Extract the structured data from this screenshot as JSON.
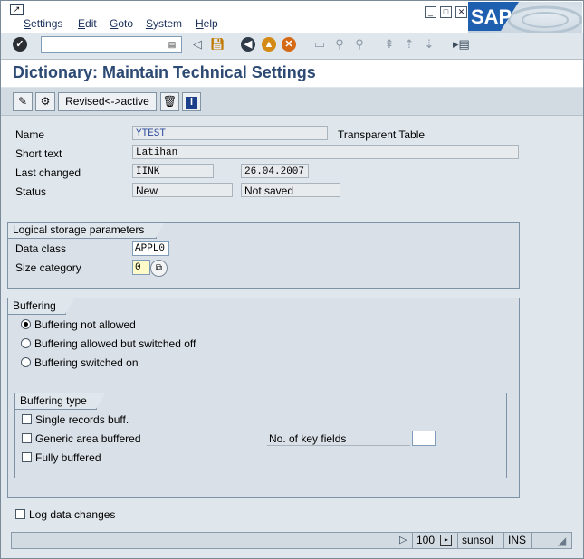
{
  "menubar": {
    "items": [
      {
        "label": "Settings"
      },
      {
        "label": "Edit"
      },
      {
        "label": "Goto"
      },
      {
        "label": "System"
      },
      {
        "label": "Help"
      }
    ],
    "logo": "SAP"
  },
  "toolbar": {
    "command_value": "",
    "icons": [
      "enter-icon",
      "save-icon",
      "back-icon",
      "exit-icon",
      "cancel-icon",
      "print-icon",
      "find-icon",
      "find-next-icon",
      "first-page-icon",
      "prev-page-icon",
      "next-page-icon",
      "layout-icon"
    ]
  },
  "title": "Dictionary: Maintain Technical Settings",
  "app_toolbar": {
    "revised_active_label": "Revised<->active"
  },
  "header_fields": {
    "name_label": "Name",
    "name_value": "YTEST",
    "table_type": "Transparent Table",
    "short_text_label": "Short text",
    "short_text_value": "Latihan",
    "last_changed_label": "Last changed",
    "last_changed_user": "IINK",
    "last_changed_date": "26.04.2007",
    "status_label": "Status",
    "status_value": "New",
    "save_status": "Not saved"
  },
  "storage": {
    "group_title": "Logical storage parameters",
    "data_class_label": "Data class",
    "data_class_value": "APPL0",
    "size_category_label": "Size category",
    "size_category_value": "0"
  },
  "buffering": {
    "group_title": "Buffering",
    "options": [
      {
        "label": "Buffering not allowed",
        "selected": true
      },
      {
        "label": "Buffering allowed but switched off",
        "selected": false
      },
      {
        "label": "Buffering switched on",
        "selected": false
      }
    ],
    "type_group_title": "Buffering type",
    "types": [
      {
        "label": "Single records buff.",
        "checked": false
      },
      {
        "label": "Generic area buffered",
        "checked": false
      },
      {
        "label": "Fully buffered",
        "checked": false
      }
    ],
    "key_fields_label": "No. of key fields",
    "key_fields_value": ""
  },
  "log_changes": {
    "label": "Log data changes",
    "checked": false
  },
  "statusbar": {
    "client": "100",
    "server": "sunsol",
    "mode": "INS"
  },
  "colors": {
    "title": "#2c4a74",
    "menu_text": "#1a2f5a",
    "selected_field_bg": "#fffbc8"
  }
}
